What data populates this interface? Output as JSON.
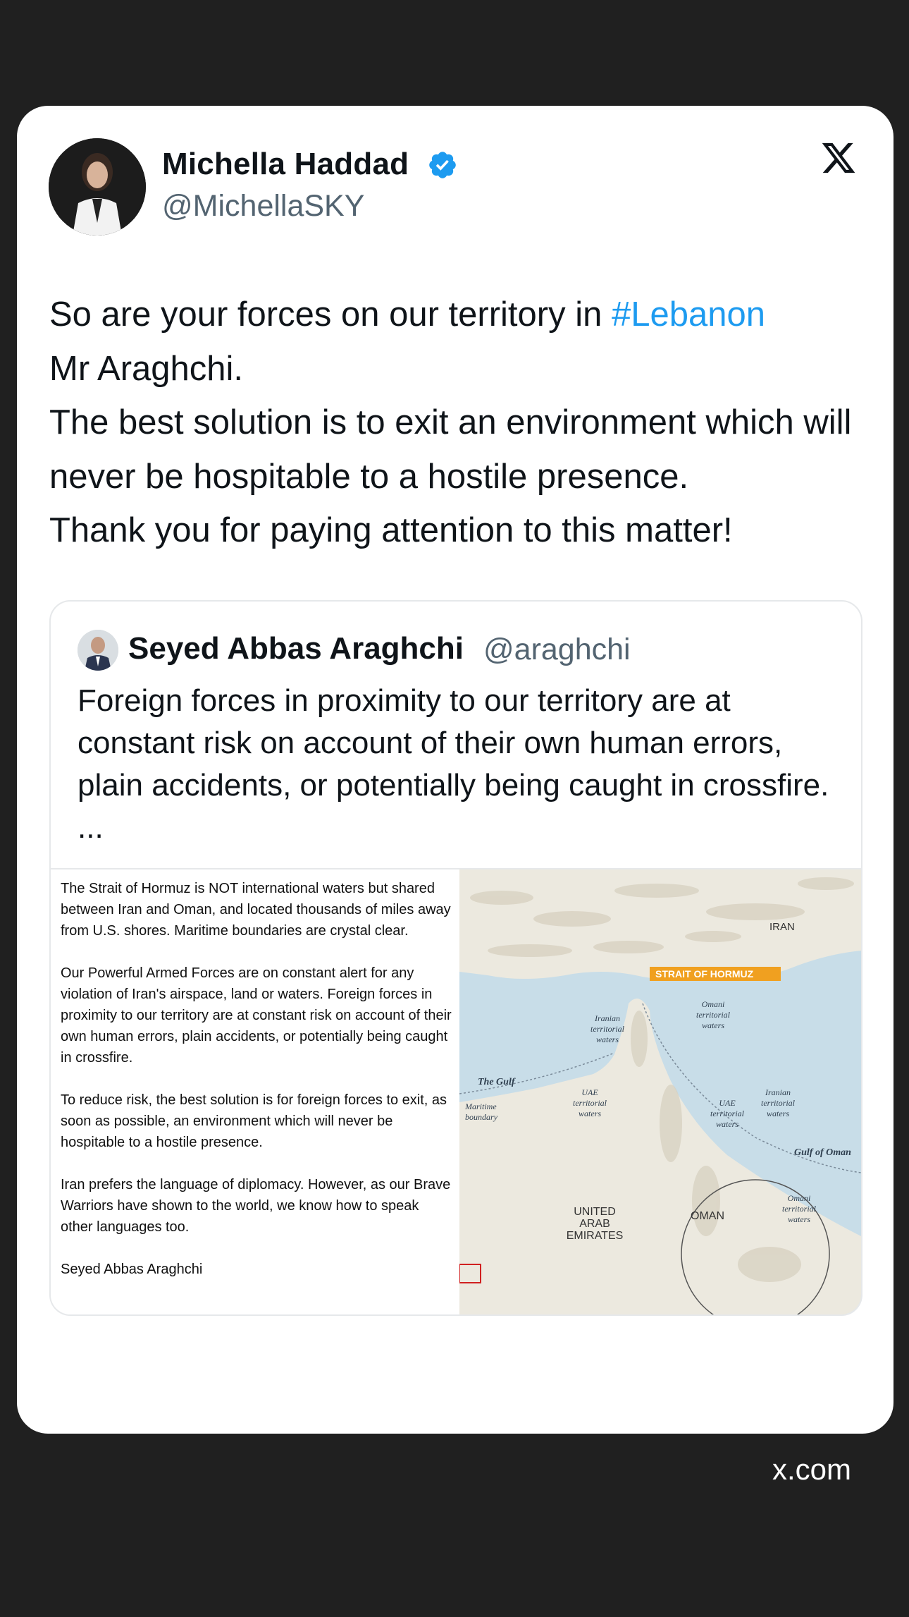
{
  "post": {
    "author": {
      "name": "Michella Haddad",
      "handle": "@MichellaSKY",
      "verified": true,
      "verified_icon": "verified-badge-icon",
      "verified_color": "#1d9bf0"
    },
    "brand_icon": "x-logo-icon",
    "text_part1": "So are your forces on our territory in ",
    "hashtag": "#Lebanon",
    "text_part2": "Mr Araghchi.",
    "text_part3": "The best solution is to exit an environment which will never be hospitable to a hostile presence.",
    "text_part4": "Thank you for paying attention to this matter!"
  },
  "quote": {
    "author": {
      "name": "Seyed Abbas Araghchi",
      "handle": "@araghchi"
    },
    "text": "Foreign forces in proximity to our territory are at constant risk on account of their own human errors, plain accidents, or potentially being caught in crossfire. ...",
    "statement": {
      "p1": "The Strait of Hormuz is NOT international waters but shared between Iran and Oman, and located thousands of miles away from U.S. shores. Maritime boundaries are crystal clear.",
      "p2": "Our Powerful Armed Forces are on constant alert for any violation of Iran's airspace, land or waters. Foreign forces in proximity to our territory are at constant risk on account of their own human errors, plain accidents, or potentially being caught in crossfire.",
      "p3": "To reduce risk, the best solution is for foreign forces to exit, as soon as possible, an environment which will never be hospitable to a hostile presence.",
      "p4": "Iran prefers the language of diplomacy. However, as our Brave Warriors have shown to the world, we know how to speak other languages too.",
      "signature": "Seyed Abbas Araghchi"
    },
    "map": {
      "iran": "IRAN",
      "strait": "STRAIT OF HORMUZ",
      "omani_waters": [
        "Omani",
        "territorial",
        "waters"
      ],
      "iranian_waters_west": [
        "Iranian",
        "territorial",
        "waters"
      ],
      "the_gulf": "The Gulf",
      "maritime_boundary": [
        "Maritime",
        "boundary"
      ],
      "uae_waters_west": [
        "UAE",
        "territorial",
        "waters"
      ],
      "uae_waters_east": [
        "UAE",
        "territorial",
        "waters"
      ],
      "iranian_waters_east": [
        "Iranian",
        "territorial",
        "waters"
      ],
      "gulf_of_oman": "Gulf of Oman",
      "uae": [
        "UNITED",
        "ARAB",
        "EMIRATES"
      ],
      "oman": "OMAN",
      "omani_waters_south": [
        "Omani",
        "territorial",
        "waters"
      ],
      "colors": {
        "sea": "#c8dde8",
        "land": "#ece9df",
        "label": "#f0a020"
      }
    }
  },
  "footer": {
    "url": "x.com"
  }
}
